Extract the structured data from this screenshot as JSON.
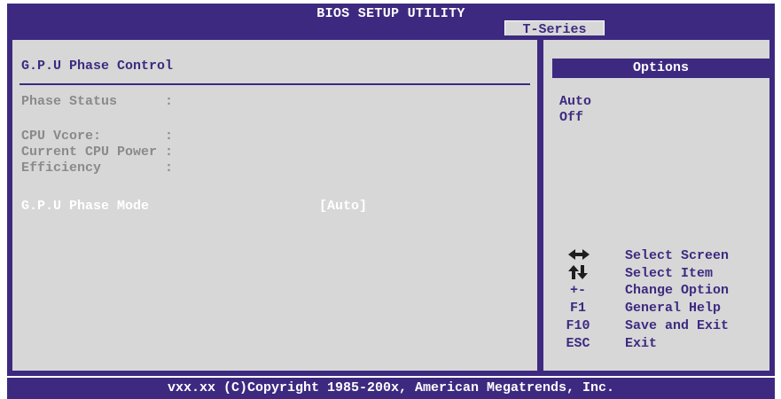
{
  "window": {
    "title": "BIOS SETUP UTILITY",
    "active_tab": "T-Series"
  },
  "main": {
    "heading": "G.P.U Phase Control",
    "rows": [
      {
        "label": "Phase Status      :"
      },
      {
        "label": "CPU Vcore:        :"
      },
      {
        "label": "Current CPU Power :"
      },
      {
        "label": "Efficiency        :"
      }
    ],
    "setting": {
      "label": "G.P.U Phase Mode",
      "value": "[Auto]"
    }
  },
  "options": {
    "header": "Options",
    "items": [
      "Auto",
      "Off"
    ]
  },
  "help": [
    {
      "key_icon": "left-right-arrows-icon",
      "text": "Select Screen"
    },
    {
      "key_icon": "up-down-arrows-icon",
      "text": "Select Item"
    },
    {
      "key": "+-",
      "text": "Change Option"
    },
    {
      "key": "F1",
      "text": "General Help"
    },
    {
      "key": "F10",
      "text": "Save and Exit"
    },
    {
      "key": "ESC",
      "text": "Exit"
    }
  ],
  "footer": "vxx.xx (C)Copyright 1985-200x, American Megatrends, Inc.",
  "colors": {
    "frame": "#3d2a80",
    "panel": "#d7d7d7",
    "text_disabled": "#8a8a8a",
    "text_selected": "#ffffff"
  }
}
